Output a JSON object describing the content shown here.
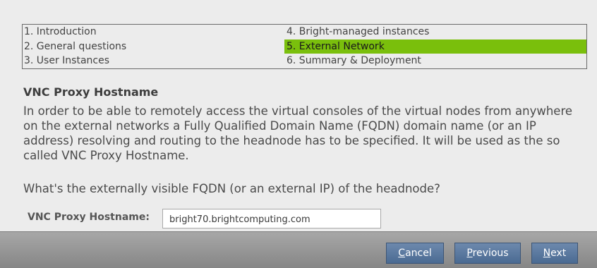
{
  "steps": [
    {
      "label": "1. Introduction",
      "active": false
    },
    {
      "label": "2. General questions",
      "active": false
    },
    {
      "label": "3. User Instances",
      "active": false
    },
    {
      "label": "4. Bright-managed instances",
      "active": false
    },
    {
      "label": "5. External Network",
      "active": true
    },
    {
      "label": "6. Summary & Deployment",
      "active": false
    }
  ],
  "section": {
    "title": "VNC Proxy Hostname",
    "description": "In order to be able to remotely access the virtual consoles of the virtual nodes from anywhere on the external networks a Fully Qualified Domain Name (FQDN) domain name (or an IP address) resolving and routing to the headnode has to be specified. It will be used as the so called VNC Proxy Hostname.",
    "question": "What's the externally visible FQDN (or an external IP) of the headnode?"
  },
  "field": {
    "label": "VNC Proxy Hostname:",
    "value": "bright70.brightcomputing.com"
  },
  "buttons": {
    "cancel": {
      "mnemonic": "C",
      "rest": "ancel"
    },
    "previous": {
      "mnemonic": "P",
      "rest": "revious"
    },
    "next": {
      "mnemonic": "N",
      "rest": "ext"
    }
  },
  "colors": {
    "active_step": "#7abf0c",
    "button": "#5a7aa0"
  }
}
